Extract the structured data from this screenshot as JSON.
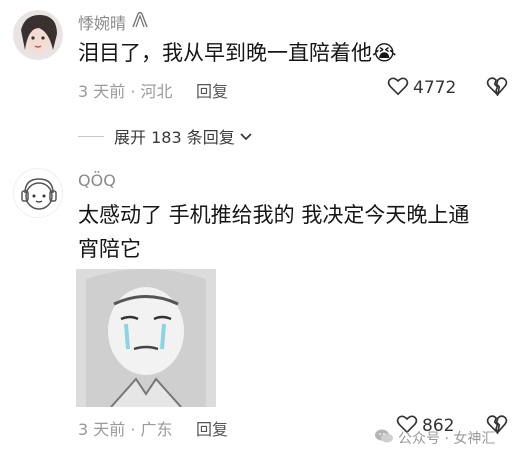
{
  "comments": [
    {
      "username": "悸婉晴",
      "text": "泪目了，我从早到晚一直陪着他😭",
      "time_location": "3 天前 · 河北",
      "reply_label": "回复",
      "likes": "4772"
    },
    {
      "username": "QÖQ",
      "text": "太感动了 手机推给我的 我决定今天晚上通宵陪它",
      "time_location": "3 天前 · 广东",
      "reply_label": "回复",
      "likes": "862"
    }
  ],
  "expand_replies": "展开 183 条回复",
  "watermark": "公众号 · 女神汇",
  "colors": {
    "heart_outline": "#333333",
    "meta_gray": "#9a9a9a",
    "text": "#161616"
  },
  "icons": {
    "verified": "hands-icon",
    "like": "heart-outline-icon",
    "dislike": "broken-heart-icon",
    "expand": "chevron-down-icon",
    "watermark": "wechat-icon"
  }
}
